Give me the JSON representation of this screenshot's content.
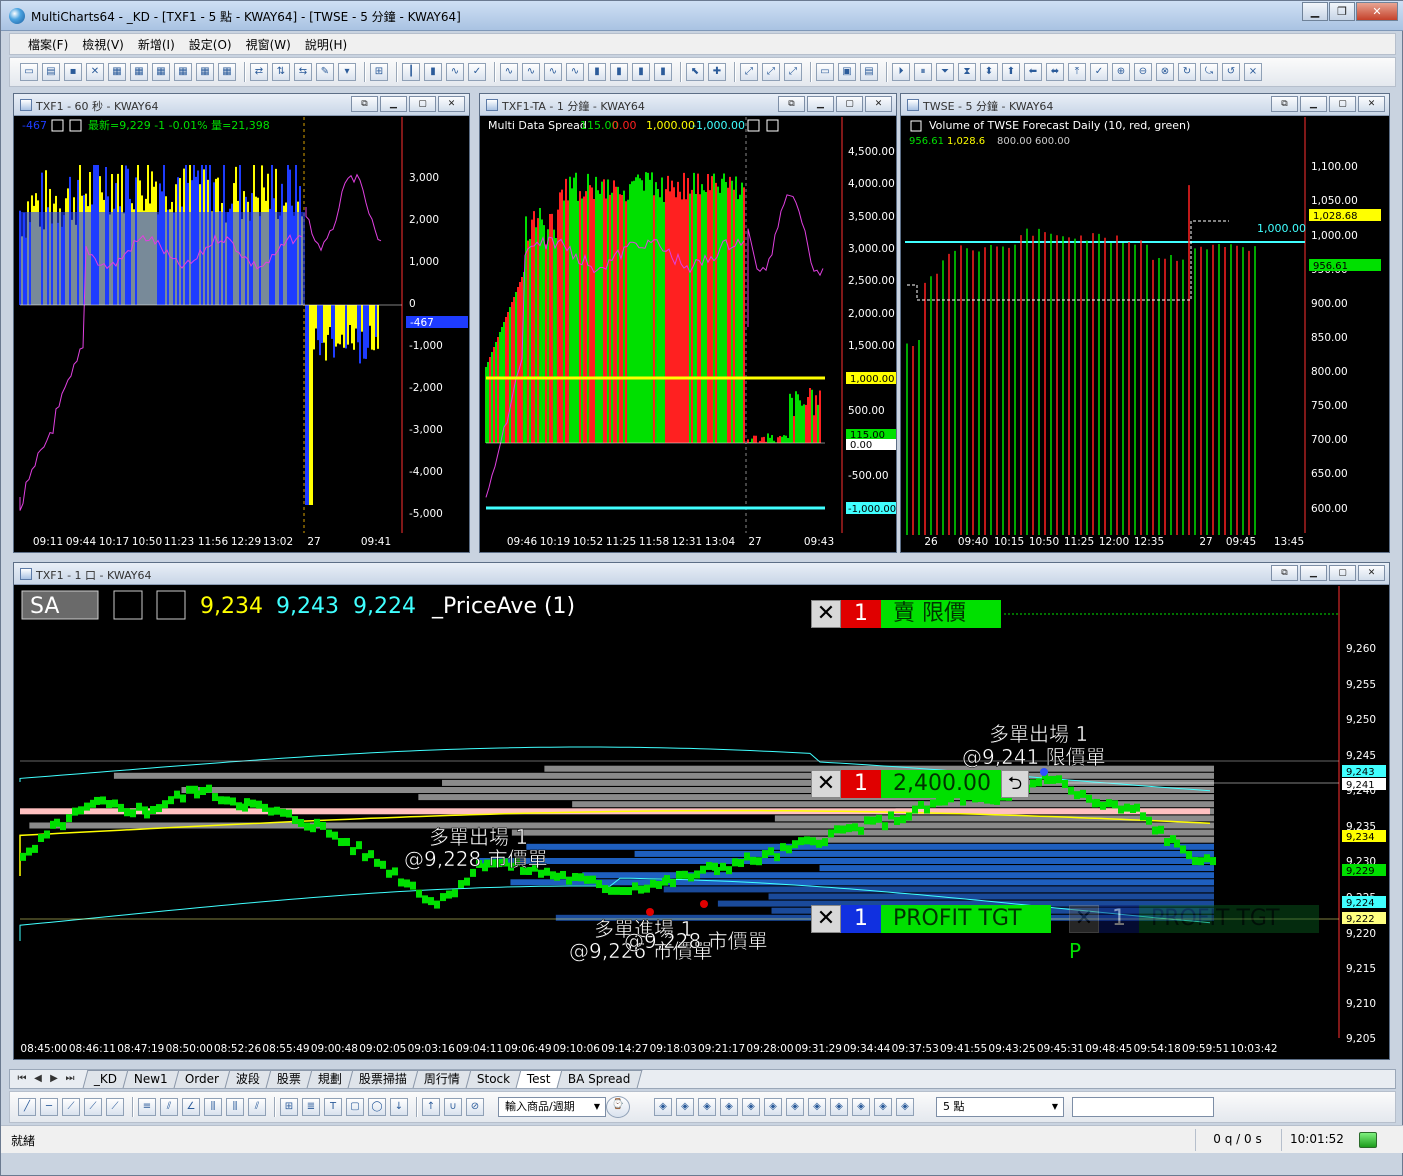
{
  "window": {
    "title": "MultiCharts64 - _KD - [TXF1 - 5 點 - KWAY64] - [TWSE - 5 分鐘 - KWAY64]"
  },
  "menu": [
    "檔案(F)",
    "檢視(V)",
    "新增(I)",
    "設定(O)",
    "視窗(W)",
    "說明(H)"
  ],
  "panel1": {
    "title": "TXF1 - 60 秒 - KWAY64",
    "ind_val": "-467",
    "status": "最新=9,229  -1  -0.01%  量=21,398",
    "yticks": [
      "3,000",
      "2,000",
      "1,000",
      "0",
      "-1,000",
      "-2,000",
      "-3,000",
      "-4,000",
      "-5,000"
    ],
    "xticks": [
      "09:11",
      "09:44",
      "10:17",
      "10:50",
      "11:23",
      "11:56",
      "12:29",
      "13:02",
      "27",
      "09:41"
    ],
    "last_label": "-467"
  },
  "panel2": {
    "title": "TXF1-TA - 1 分鐘 - KWAY64",
    "ind_name": "Multi Data Spread",
    "v1": "115.00",
    "v2": "0.00",
    "v3": "1,000.00",
    "v4": "-1,000.00",
    "yticks": [
      "4,500.00",
      "4,000.00",
      "3,500.00",
      "3,000.00",
      "2,500.00",
      "2,000.00",
      "1,500.00",
      "1,000.00",
      "500.00",
      "115.00",
      "0.00",
      "-500.00",
      "-1,000.00"
    ],
    "xticks": [
      "09:46",
      "10:19",
      "10:52",
      "11:25",
      "11:58",
      "12:31",
      "13:04",
      "27",
      "09:43"
    ],
    "tag_1000": "1,000.00",
    "tag_115": "115.00",
    "tag_0": "0.00",
    "tag_m1000": "-1,000.00"
  },
  "panel3": {
    "title": "TWSE - 5 分鐘 - KWAY64",
    "ind_name": "Volume of TWSE Forecast Daily  (10,  red,  green)",
    "v1": "956.61",
    "v2": "1,028.6",
    "v3": "800.00",
    "v4": "600.00",
    "yticks": [
      "1,100.00",
      "1,050.00",
      "1,000.00",
      "950.00",
      "900.00",
      "850.00",
      "800.00",
      "750.00",
      "700.00",
      "650.00",
      "600.00"
    ],
    "xticks": [
      "26",
      "09:40",
      "10:15",
      "10:50",
      "11:25",
      "12:00",
      "12:35",
      "27",
      "09:45",
      "13:45"
    ],
    "tag_1028": "1,028.68",
    "tag_1000": "1,000.00",
    "tag_956": "956.61"
  },
  "panel4": {
    "title": "TXF1 - 1 口 - KWAY64",
    "sa": "SA",
    "p1": "9,234",
    "p2": "9,243",
    "p3": "9,224",
    "ind": "_PriceAve  (1)",
    "yticks": [
      "9,260",
      "9,255",
      "9,250",
      "9,245",
      "9,240",
      "9,235",
      "9,230",
      "9,225",
      "9,220",
      "9,215",
      "9,210",
      "9,205"
    ],
    "xticks": [
      "08:45:00",
      "08:46:11",
      "08:47:19",
      "08:50:00",
      "08:52:26",
      "08:55:49",
      "09:00:48",
      "09:02:05",
      "09:03:16",
      "09:04:11",
      "09:06:49",
      "09:10:06",
      "09:14:27",
      "09:18:03",
      "09:21:17",
      "09:28:00",
      "09:31:29",
      "09:34:44",
      "09:37:53",
      "09:41:55",
      "09:43:25",
      "09:45:31",
      "09:48:45",
      "09:54:18",
      "09:59:51",
      "10:03:42"
    ],
    "tags": {
      "t9243": "9,243",
      "t9241": "9,241",
      "t9234": "9,234",
      "t9229": "9,229",
      "t9224": "9,224",
      "t9222": "9,222"
    },
    "orders": {
      "sell_qty": "1",
      "sell_label": "賣 限價",
      "mid_qty": "1",
      "mid_label": "2,400.00",
      "pt_qty": "1",
      "pt_label": "PROFIT TGT",
      "pt2_qty": "1",
      "pt2_label": "PROFIT TGT",
      "close": "✕"
    },
    "annotations": {
      "a1_line1": "多單出場 1",
      "a1_line2": "@9,241 限價單",
      "a2_line1": "多單出場 1",
      "a2_line2": "@9,228 市價單",
      "a3_line1": "多單進場 1",
      "a3_line2": "@9,226 市價單",
      "a4_line2": "@9,228 市價單",
      "p_marker": "P"
    }
  },
  "tabs": [
    "_KD",
    "New1",
    "Order",
    "波段",
    "股票",
    "規劃",
    "股票掃描",
    "周行情",
    "Stock",
    "Test",
    "BA Spread"
  ],
  "active_tab": "Test",
  "drawbar": {
    "symbol_input": "輸入商品/週期",
    "interval": "5 點"
  },
  "status": {
    "ready": "就緒",
    "queue": "0 q / 0 s",
    "time": "10:01:52"
  },
  "colors": {
    "up": "#00e000",
    "down": "#ff2020",
    "yellow": "#ffff00",
    "blue": "#1e3cff",
    "cyan": "#40ffff",
    "magenta": "#e040e0"
  }
}
